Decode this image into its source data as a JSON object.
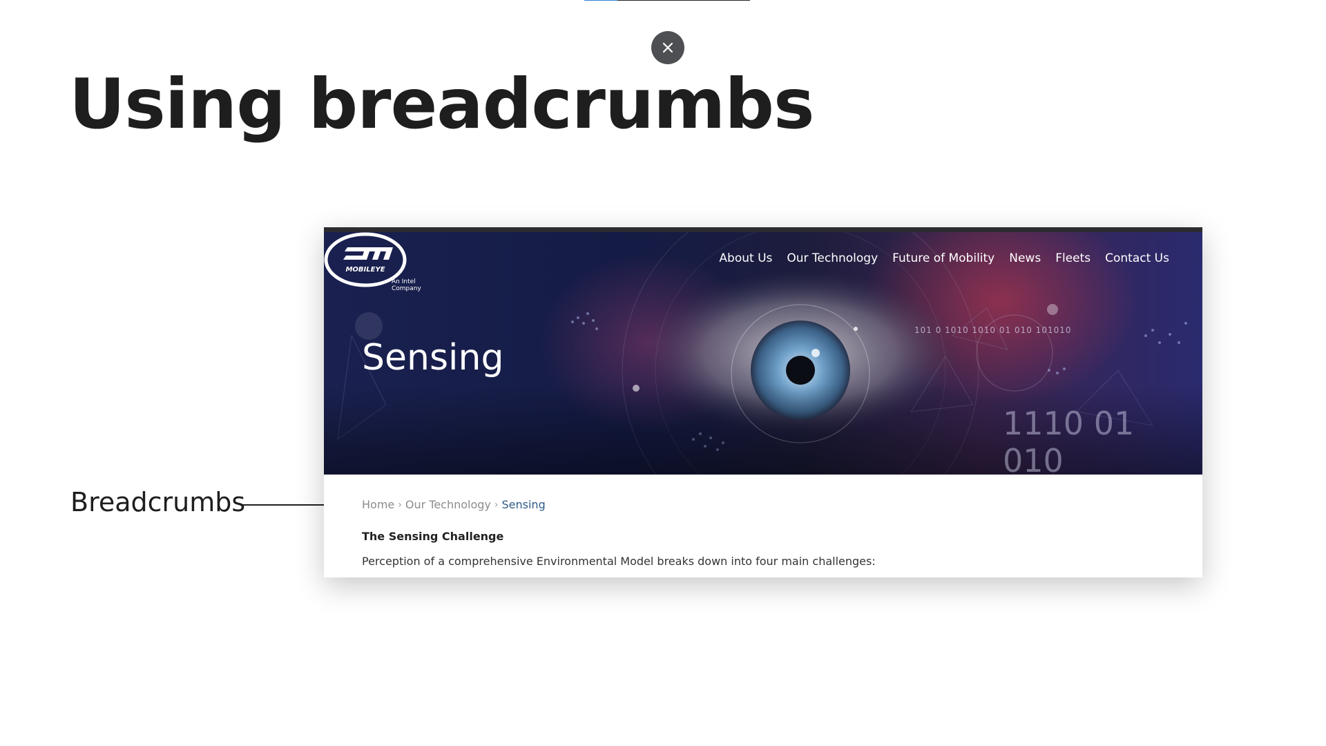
{
  "slide": {
    "title": "Using breadcrumbs",
    "callout_label": "Breadcrumbs",
    "progress": 0.2
  },
  "website": {
    "logo": {
      "brand": "MOBILEYE",
      "tagline_line1": "An Intel",
      "tagline_line2": "Company"
    },
    "nav": [
      "About Us",
      "Our Technology",
      "Future of Mobility",
      "News",
      "Fleets",
      "Contact Us"
    ],
    "hero_title": "Sensing",
    "binary_small": "101 0   1010 1010 01 010 101010",
    "binary_large": "1110  01 010",
    "breadcrumbs": [
      "Home",
      "Our Technology",
      "Sensing"
    ],
    "section_heading": "The Sensing Challenge",
    "body_text": "Perception of a comprehensive Environmental Model breaks down into four main challenges:"
  }
}
